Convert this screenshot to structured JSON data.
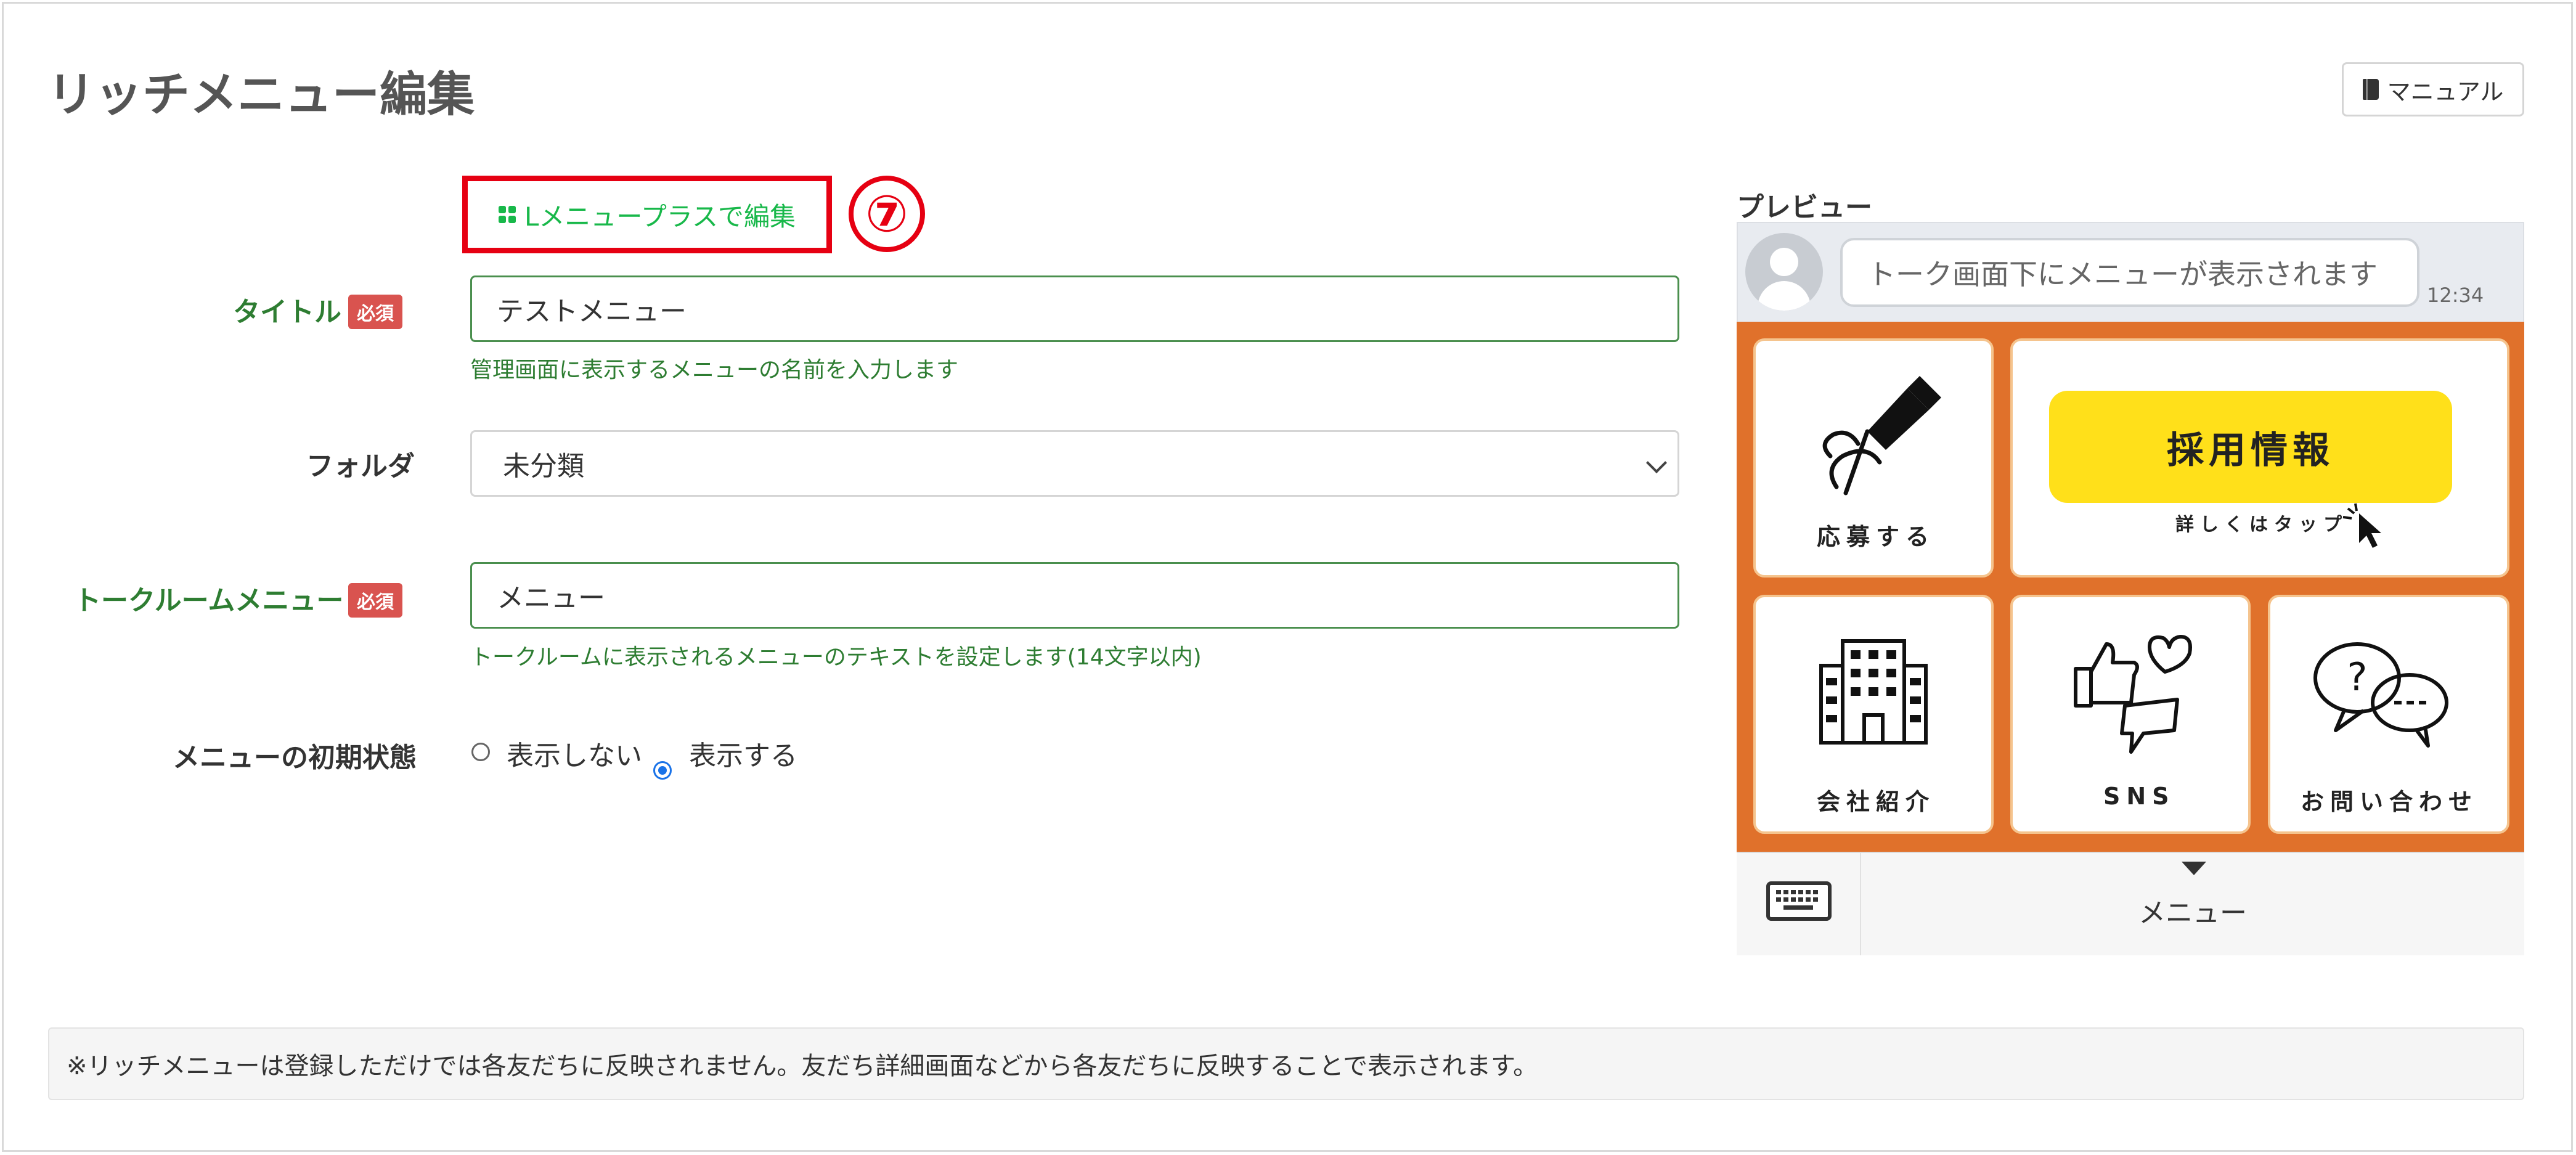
{
  "page": {
    "title": "リッチメニュー編集"
  },
  "header": {
    "manual_label": "マニュアル"
  },
  "lmenu": {
    "button_label": "Lメニュープラスで編集",
    "step_number": "⑦"
  },
  "form": {
    "title": {
      "label": "タイトル",
      "required": "必須",
      "value": "テストメニュー",
      "help": "管理画面に表示するメニューの名前を入力します"
    },
    "folder": {
      "label": "フォルダ",
      "selected": "未分類"
    },
    "talkroom": {
      "label": "トークルームメニュー",
      "required": "必須",
      "value": "メニュー",
      "help": "トークルームに表示されるメニューのテキストを設定します(14文字以内)"
    },
    "initial_state": {
      "label": "メニューの初期状態",
      "options": [
        "表示しない",
        "表示する"
      ],
      "selected": "表示する"
    }
  },
  "preview": {
    "label": "プレビュー",
    "bubble_text": "トーク画面下にメニューが表示されます",
    "time": "12:34",
    "tiles": {
      "apply": "応募する",
      "recruit_title": "採用情報",
      "recruit_sub": "詳しくはタップ",
      "company": "会社紹介",
      "sns": "SNS",
      "contact": "お問い合わせ"
    },
    "menu_label": "メニュー"
  },
  "notice": "※リッチメニューは登録しただけでは各友だちに反映されません。友だち詳細画面などから各友だちに反映することで表示されます。",
  "colors": {
    "accent_green": "#18b84a",
    "label_green": "#2e7d32",
    "highlight_red": "#e60012",
    "menu_orange": "#e0712b",
    "button_yellow": "#ffe01a"
  }
}
